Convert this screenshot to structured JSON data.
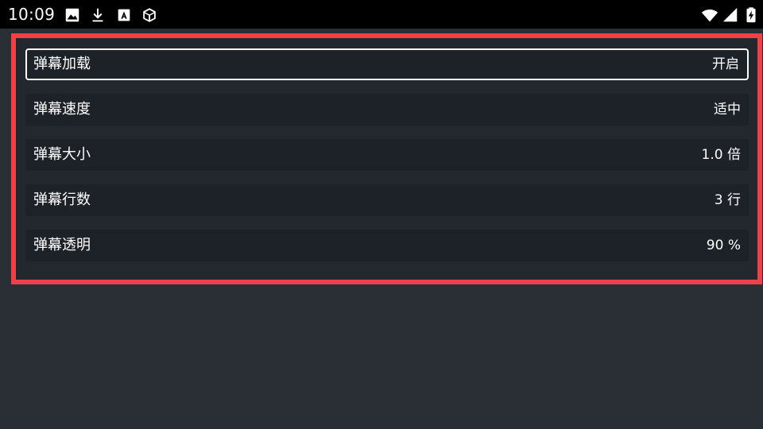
{
  "status_bar": {
    "time": "10:09",
    "left_icons": [
      "image-icon",
      "download-icon",
      "a-letter-icon",
      "cube-icon"
    ],
    "right_icons": [
      "wifi-icon",
      "signal-icon",
      "battery-charging-icon"
    ]
  },
  "settings": {
    "items": [
      {
        "label": "弹幕加载",
        "value": "开启",
        "focused": true
      },
      {
        "label": "弹幕速度",
        "value": "适中",
        "focused": false
      },
      {
        "label": "弹幕大小",
        "value": "1.0 倍",
        "focused": false
      },
      {
        "label": "弹幕行数",
        "value": "3 行",
        "focused": false
      },
      {
        "label": "弹幕透明",
        "value": "90 %",
        "focused": false
      }
    ]
  },
  "colors": {
    "background": "#2a2f36",
    "panel_border": "#ef4048",
    "item_background": "#1c2227",
    "text": "#ffffff"
  }
}
